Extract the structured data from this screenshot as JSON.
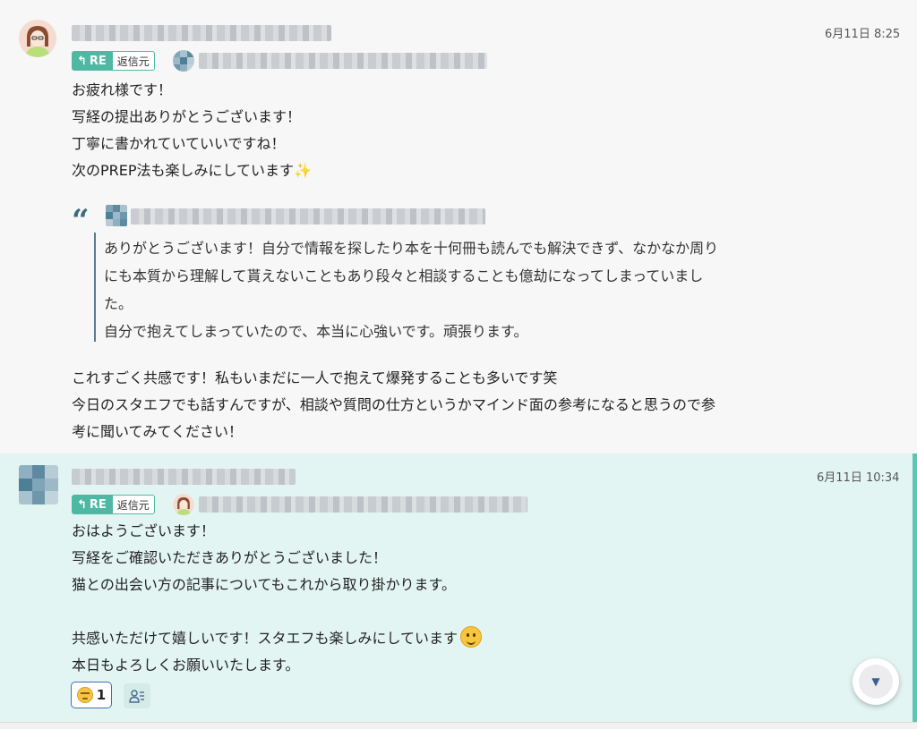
{
  "messages": [
    {
      "time": "6月11日 8:25",
      "reply_tag": "RE",
      "reply_source": "返信元",
      "body": [
        "お疲れ様です！",
        "写経の提出ありがとうございます！",
        "丁寧に書かれていていいですね！",
        "次のPREP法も楽しみにしています✨"
      ],
      "quote_mark": "“",
      "quote": [
        "ありがとうございます！自分で情報を探したり本を十何冊も読んでも解決できず、なかなか周り",
        "にも本質から理解して貰えないこともあり段々と相談することも億劫になってしまっていまし",
        "た。",
        "自分で抱えてしまっていたので、本当に心強いです。頑張ります。"
      ],
      "body2": [
        "これすごく共感です！私もいまだに一人で抱えて爆発することも多いです笑",
        "今日のスタエフでも話すんですが、相談や質問の仕方というかマインド面の参考になると思うので参",
        "考に聞いてみてください！"
      ]
    },
    {
      "time": "6月11日 10:34",
      "reply_tag": "RE",
      "reply_source": "返信元",
      "body": [
        "おはようございます！",
        "写経をご確認いただきありがとうございました！",
        "猫との出会い方の記事についてもこれから取り掛かります。",
        "",
        "共感いただけて嬉しいです！スタエフも楽しみにしています",
        "本日もよろしくお願いいたします。"
      ],
      "reaction_count": "1"
    }
  ],
  "icons": {
    "reply_arrow": "↰",
    "scroll_down": "▼"
  },
  "colors": {
    "accent": "#4fb8a2",
    "highlight_bg": "#e3f5f2",
    "reaction_border": "#3f6fb6"
  }
}
